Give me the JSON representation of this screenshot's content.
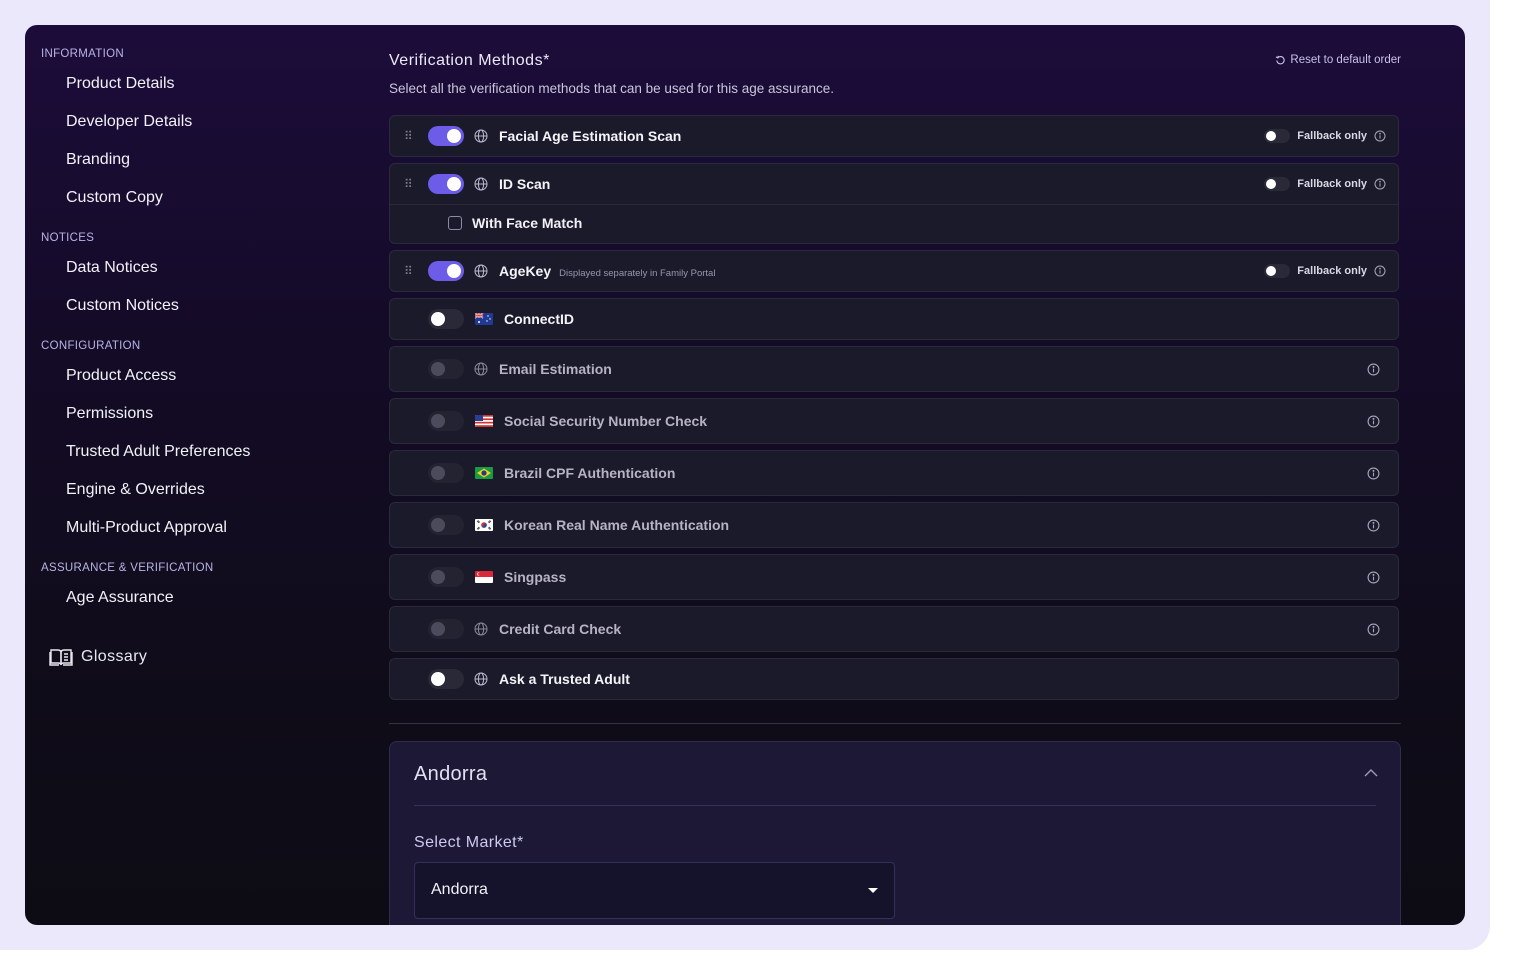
{
  "sidebar": {
    "sections": [
      {
        "title": "INFORMATION",
        "items": [
          "Product Details",
          "Developer Details",
          "Branding",
          "Custom Copy"
        ]
      },
      {
        "title": "NOTICES",
        "items": [
          "Data Notices",
          "Custom Notices"
        ]
      },
      {
        "title": "CONFIGURATION",
        "items": [
          "Product Access",
          "Permissions",
          "Trusted Adult Preferences",
          "Engine & Overrides",
          "Multi-Product Approval"
        ]
      },
      {
        "title": "ASSURANCE & VERIFICATION",
        "items": [
          "Age Assurance"
        ]
      }
    ],
    "glossary_label": "Glossary"
  },
  "verification": {
    "title": "Verification Methods*",
    "subtitle": "Select all the verification methods that can be used for this age assurance.",
    "reset_label": "Reset to default order",
    "fallback_label": "Fallback only",
    "methods": [
      {
        "label": "Facial Age Estimation Scan",
        "enabled": true,
        "icon": "globe-icon"
      },
      {
        "label": "ID Scan",
        "enabled": true,
        "icon": "globe-icon",
        "sub_option": "With Face Match"
      },
      {
        "label": "AgeKey",
        "enabled": true,
        "icon": "globe-icon",
        "note": "Displayed separately in Family Portal"
      },
      {
        "label": "ConnectID",
        "enabled": false,
        "icon": "australia-flag-icon"
      },
      {
        "label": "Email Estimation",
        "enabled": false,
        "disabled": true,
        "icon": "globe-icon"
      },
      {
        "label": "Social Security Number Check",
        "enabled": false,
        "disabled": true,
        "icon": "usa-flag-icon"
      },
      {
        "label": "Brazil CPF Authentication",
        "enabled": false,
        "disabled": true,
        "icon": "brazil-flag-icon"
      },
      {
        "label": "Korean Real Name Authentication",
        "enabled": false,
        "disabled": true,
        "icon": "korea-flag-icon"
      },
      {
        "label": "Singpass",
        "enabled": false,
        "disabled": true,
        "icon": "singapore-flag-icon"
      },
      {
        "label": "Credit Card Check",
        "enabled": false,
        "disabled": true,
        "icon": "globe-icon"
      },
      {
        "label": "Ask a Trusted Adult",
        "enabled": false,
        "icon": "globe-icon"
      }
    ]
  },
  "market": {
    "title": "Andorra",
    "select_label": "Select Market*",
    "selected": "Andorra"
  },
  "colors": {
    "accent": "#6d5ce8",
    "background_top": "#1c0c3a",
    "background_bottom": "#0d0c14",
    "frame": "#ebe8fb"
  }
}
